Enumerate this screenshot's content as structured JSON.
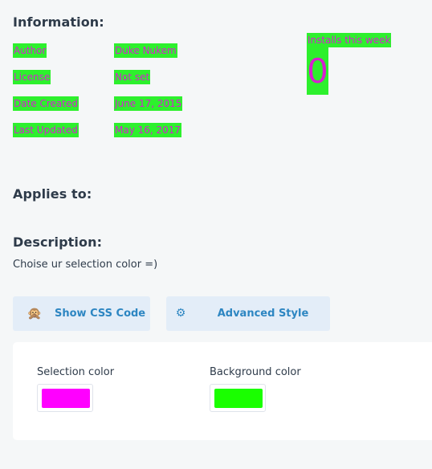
{
  "information": {
    "title": "Information:",
    "rows": [
      {
        "label": "Author",
        "value": "Duke Nukem"
      },
      {
        "label": "License",
        "value": "Not set"
      },
      {
        "label": "Date Created",
        "value": "June 17, 2015"
      },
      {
        "label": "Last Updated",
        "value": "May 16, 2017"
      }
    ]
  },
  "installs": {
    "label": "Installs this week",
    "count": "0"
  },
  "applies_to": {
    "title": "Applies to:"
  },
  "description": {
    "title": "Description:",
    "text": "Choise ur selection color =)"
  },
  "buttons": {
    "show_css": {
      "label": "Show CSS Code",
      "icon": "monkey-icon"
    },
    "advanced": {
      "label": "Advanced Style Settings",
      "icon": "gear-icon"
    }
  },
  "settings": {
    "selection_color": {
      "label": "Selection color",
      "value": "#ff00ff"
    },
    "background_color": {
      "label": "Background color",
      "value": "#1aff00"
    }
  },
  "colors": {
    "highlight_bg": "#2df02d",
    "highlight_text": "#d81fd1",
    "button_bg": "#e3edf8",
    "button_text": "#2d86c2",
    "heading_text": "#2e3b4a",
    "page_bg": "#f5f7f8"
  }
}
